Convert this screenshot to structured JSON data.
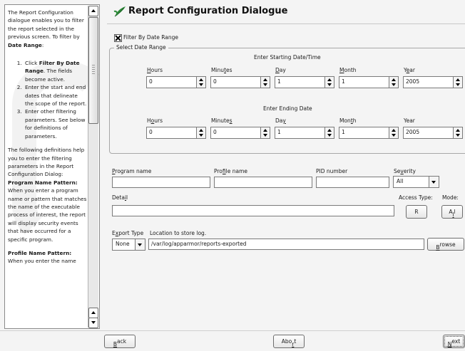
{
  "help": {
    "intro": [
      "The Report Configuration dialogue enables you to filter the report selected in the previous screen. To filter by ",
      "Date Range",
      ":"
    ],
    "steps": [
      {
        "pre": "Click ",
        "bold": "Filter By Date Range",
        "post": ". The fields become active."
      },
      {
        "pre": "Enter the start and end dates that delineate the scope of the report.",
        "bold": "",
        "post": ""
      },
      {
        "pre": "Enter other filtering parameters. See below for definitions of parameters.",
        "bold": "",
        "post": ""
      }
    ],
    "defs_pre": "The following definitions help you to enter the filtering parameters in the Report Configuration Dialog: ",
    "defs_bold": "Program Name Pattern:",
    "defs_post": " When you enter a program name or pattern that matches the name of the executable process of interest, the report will display security events that have occurred for a specific program.",
    "profile_bold": "Profile Name Pattern:",
    "profile_post": " When you enter the name"
  },
  "title": "Report Configuration Dialogue",
  "filter_checkbox": {
    "label": "Filter By Date Range",
    "checked": true
  },
  "date_group": {
    "legend": "Select Date Range",
    "start_caption": "Enter Starting Date/Time",
    "end_caption": "Enter Ending Date",
    "start": {
      "hours": {
        "label": "Hours",
        "value": "0"
      },
      "minutes": {
        "label": "Minutes",
        "value": "0"
      },
      "day": {
        "label": "Day",
        "value": "1"
      },
      "month": {
        "label": "Month",
        "value": "1"
      },
      "year": {
        "label": "Year",
        "value": "2005"
      }
    },
    "end": {
      "hours": {
        "label": "Hours",
        "value": "0"
      },
      "minutes": {
        "label": "Minutes",
        "value": "0"
      },
      "day": {
        "label": "Day",
        "value": "1"
      },
      "month": {
        "label": "Month",
        "value": "1"
      },
      "year": {
        "label": "Year",
        "value": "2005"
      }
    }
  },
  "filters": {
    "program_label": "Program name",
    "program_value": "",
    "profile_label": "Profile name",
    "profile_value": "",
    "pid_label": "PID number",
    "pid_value": "",
    "severity_label": "Severity",
    "severity_value": "All",
    "detail_label": "Detail",
    "detail_value": "",
    "access_label": "Access Type:",
    "access_button": "R",
    "mode_label": "Mode:",
    "mode_button": "All"
  },
  "export": {
    "type_label": "Export Type",
    "type_value": "None",
    "location_label": "Location to store log.",
    "location_value": "/var/log/apparmor/reports-exported",
    "browse_label": "Browse"
  },
  "footer": {
    "back": "Back",
    "abort": "Abort",
    "next": "Next"
  },
  "colors": {
    "window_bg": "#f4f4f4",
    "title_icon": "#2e8b3a"
  }
}
